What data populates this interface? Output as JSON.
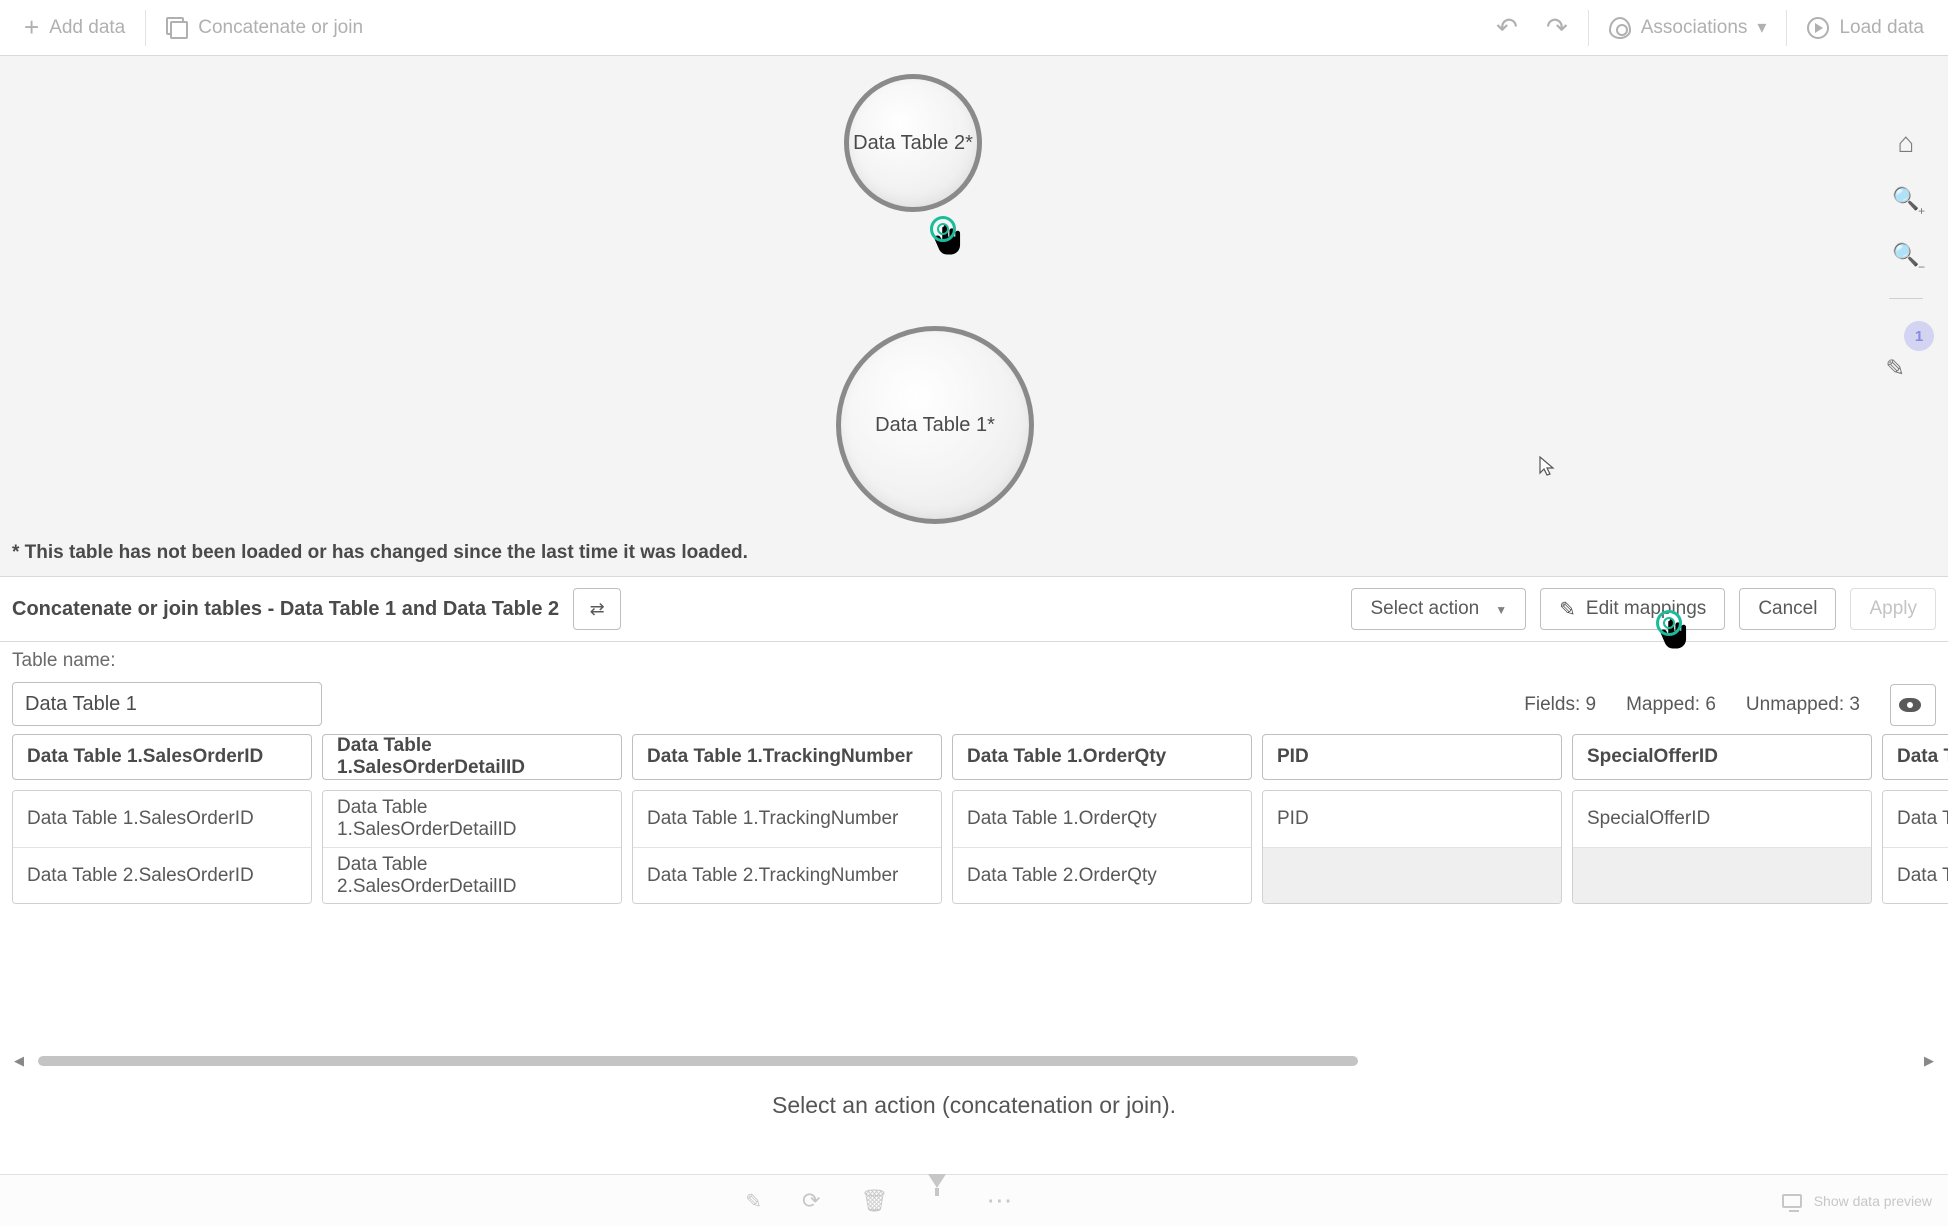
{
  "topbar": {
    "add_data": "Add data",
    "concat_join": "Concatenate or join",
    "associations": "Associations",
    "load_data": "Load data"
  },
  "canvas": {
    "bubble_small": "Data Table 2*",
    "bubble_large": "Data Table 1*",
    "footnote": "* This table has not been loaded or has changed since the last time it was loaded."
  },
  "sidetools": {
    "badge": "1"
  },
  "configbar": {
    "title": "Concatenate or join tables - Data Table 1 and Data Table 2",
    "select_action": "Select action",
    "edit_mappings": "Edit mappings",
    "cancel": "Cancel",
    "apply": "Apply"
  },
  "meta": {
    "table_name_label": "Table name:",
    "table_name_value": "Data Table 1",
    "fields_label": "Fields:",
    "fields_value": "9",
    "mapped_label": "Mapped:",
    "mapped_value": "6",
    "unmapped_label": "Unmapped:",
    "unmapped_value": "3"
  },
  "columns": [
    {
      "header": "Data Table 1.SalesOrderID",
      "rows": [
        "Data Table 1.SalesOrderID",
        "Data Table 2.SalesOrderID"
      ],
      "row_empty": [
        false,
        false
      ]
    },
    {
      "header": "Data Table 1.SalesOrderDetailID",
      "rows": [
        "Data Table 1.SalesOrderDetailID",
        "Data Table 2.SalesOrderDetailID"
      ],
      "row_empty": [
        false,
        false
      ]
    },
    {
      "header": "Data Table 1.TrackingNumber",
      "rows": [
        "Data Table 1.TrackingNumber",
        "Data Table 2.TrackingNumber"
      ],
      "row_empty": [
        false,
        false
      ]
    },
    {
      "header": "Data Table 1.OrderQty",
      "rows": [
        "Data Table 1.OrderQty",
        "Data Table 2.OrderQty"
      ],
      "row_empty": [
        false,
        false
      ]
    },
    {
      "header": "PID",
      "rows": [
        "PID",
        ""
      ],
      "row_empty": [
        false,
        true
      ]
    },
    {
      "header": "SpecialOfferID",
      "rows": [
        "SpecialOfferID",
        ""
      ],
      "row_empty": [
        false,
        true
      ]
    },
    {
      "header": "Data Ta",
      "rows": [
        "Data Ta",
        "Data Ta"
      ],
      "row_empty": [
        false,
        false
      ]
    }
  ],
  "prompt": "Select an action (concatenation or join).",
  "bottombar": {
    "show_preview": "Show data preview"
  }
}
